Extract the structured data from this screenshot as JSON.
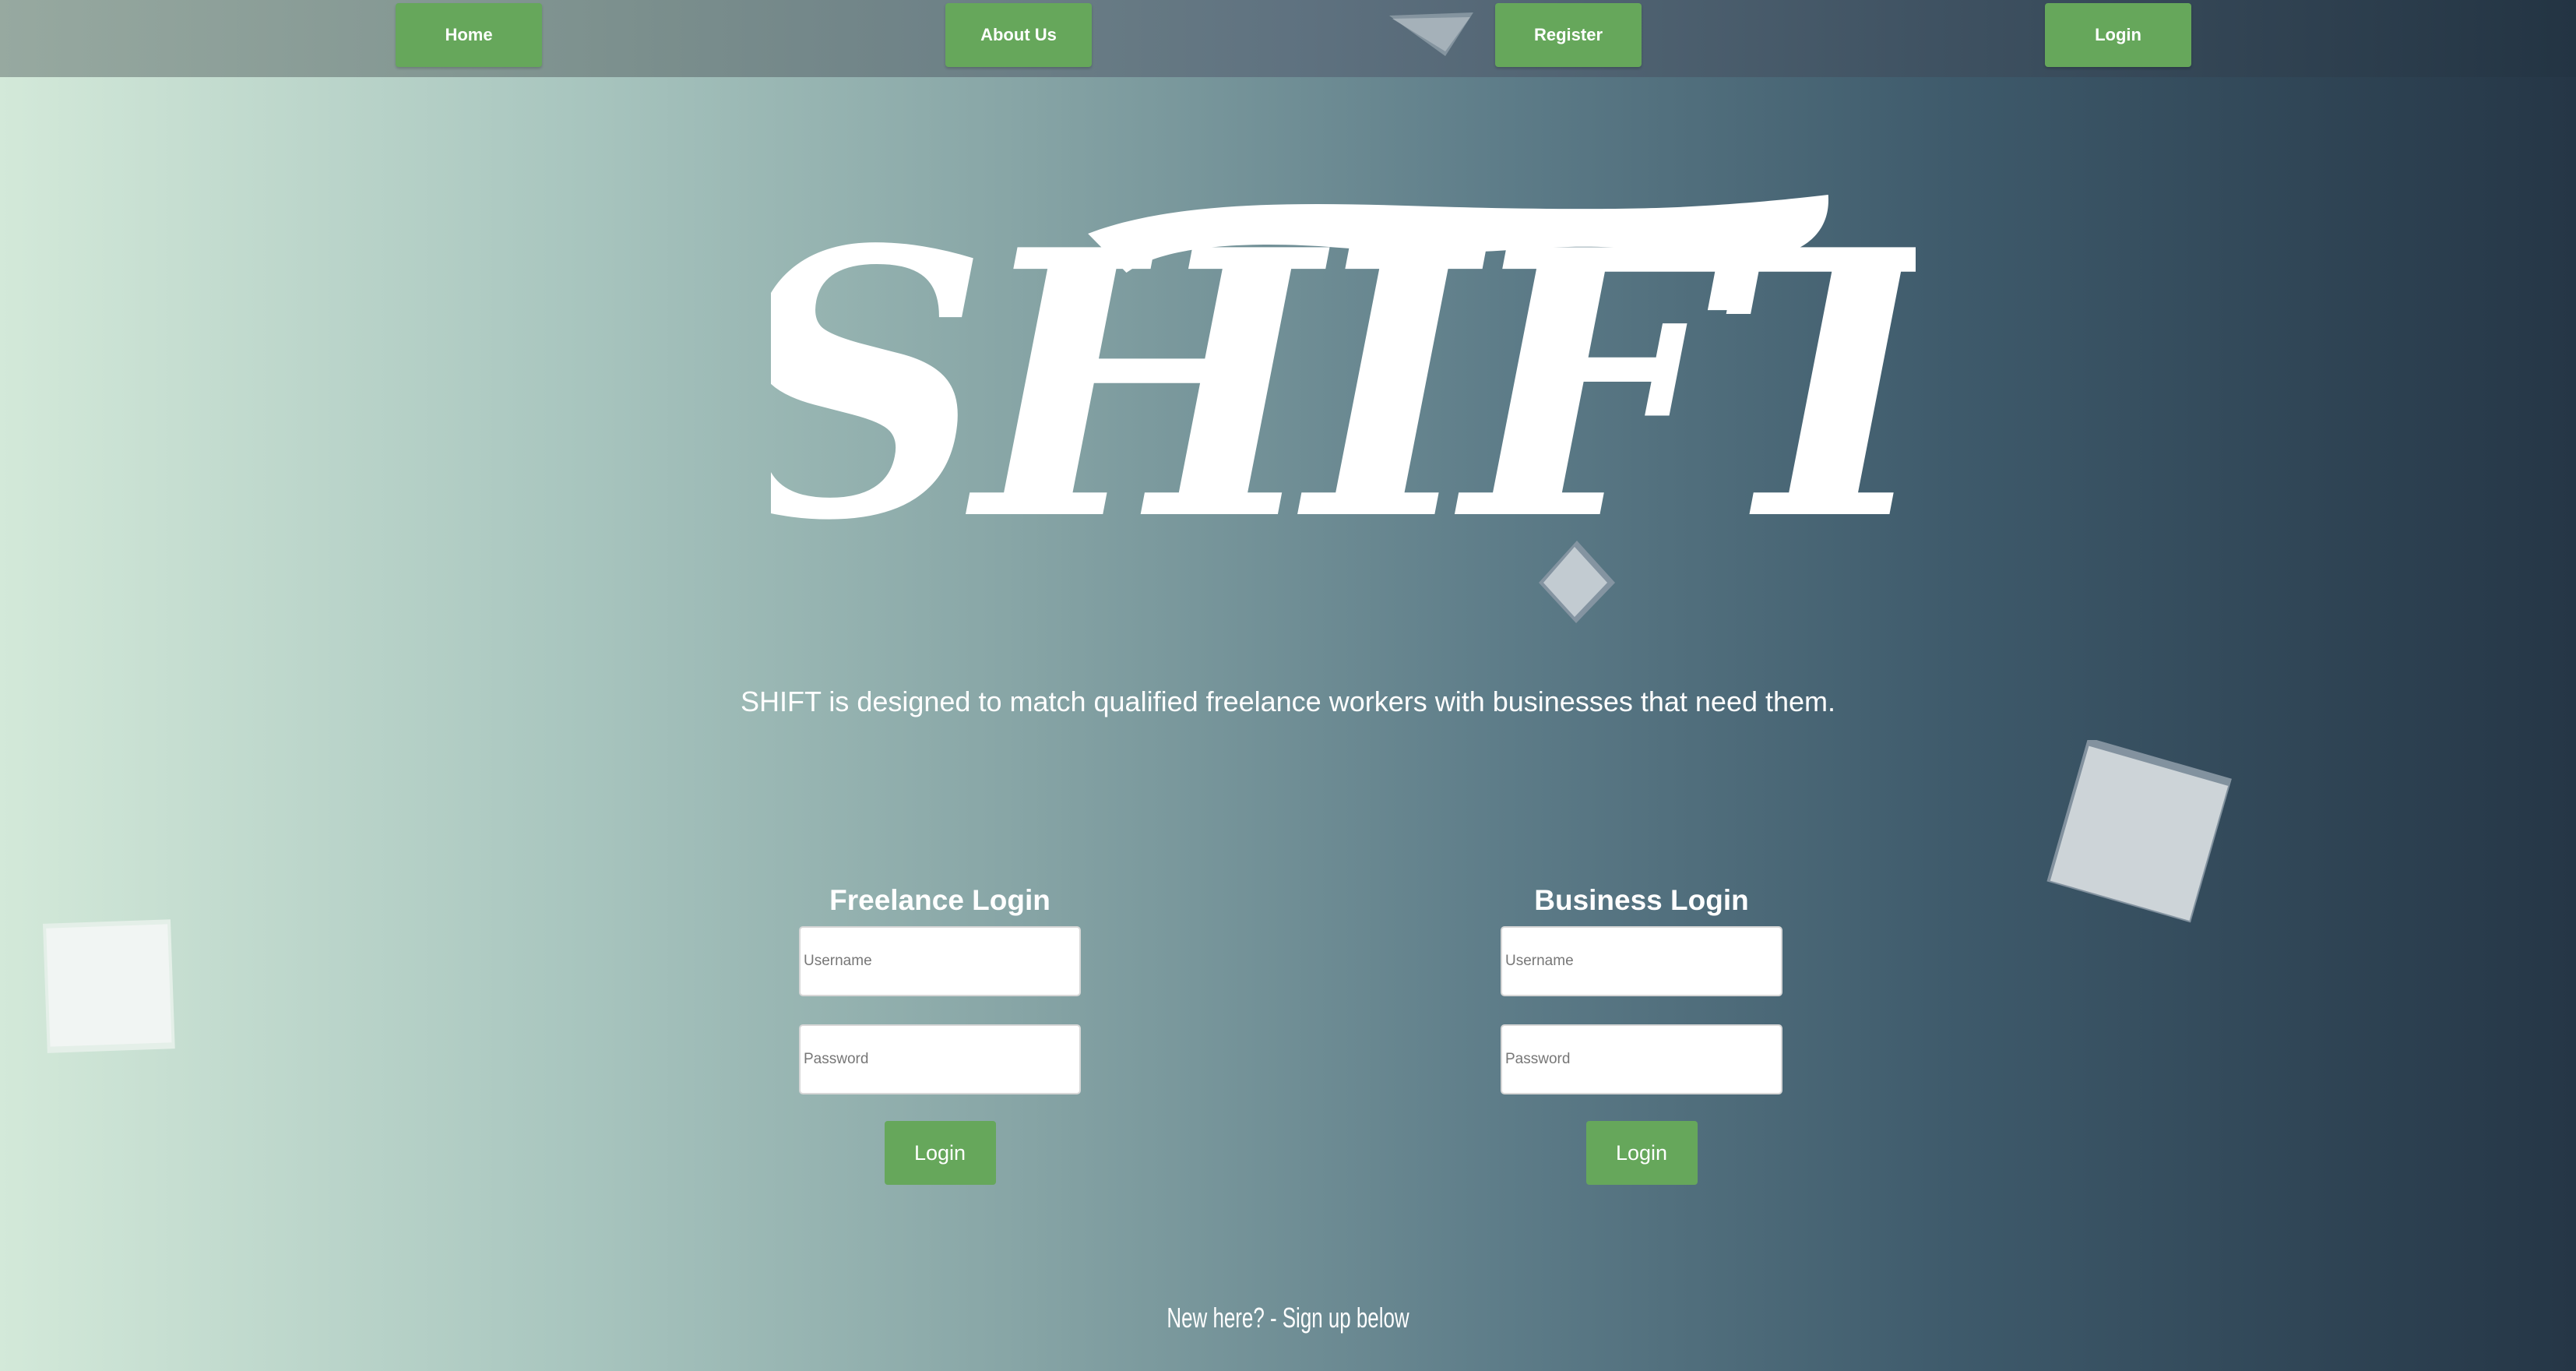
{
  "nav": {
    "home": "Home",
    "about": "About Us",
    "register": "Register",
    "login": "Login"
  },
  "logo_text": "SHIFT",
  "tagline": "SHIFT is designed to match qualified freelance workers with businesses that need them.",
  "freelance": {
    "title": "Freelance Login",
    "username_placeholder": "Username",
    "password_placeholder": "Password",
    "button": "Login"
  },
  "business": {
    "title": "Business Login",
    "username_placeholder": "Username",
    "password_placeholder": "Password",
    "button": "Login"
  },
  "signup_text": "New here? - Sign up below",
  "colors": {
    "accent_green": "#66a75b",
    "text": "#ffffff",
    "gradient_start": "#d3e9d9",
    "gradient_end": "#253646"
  }
}
